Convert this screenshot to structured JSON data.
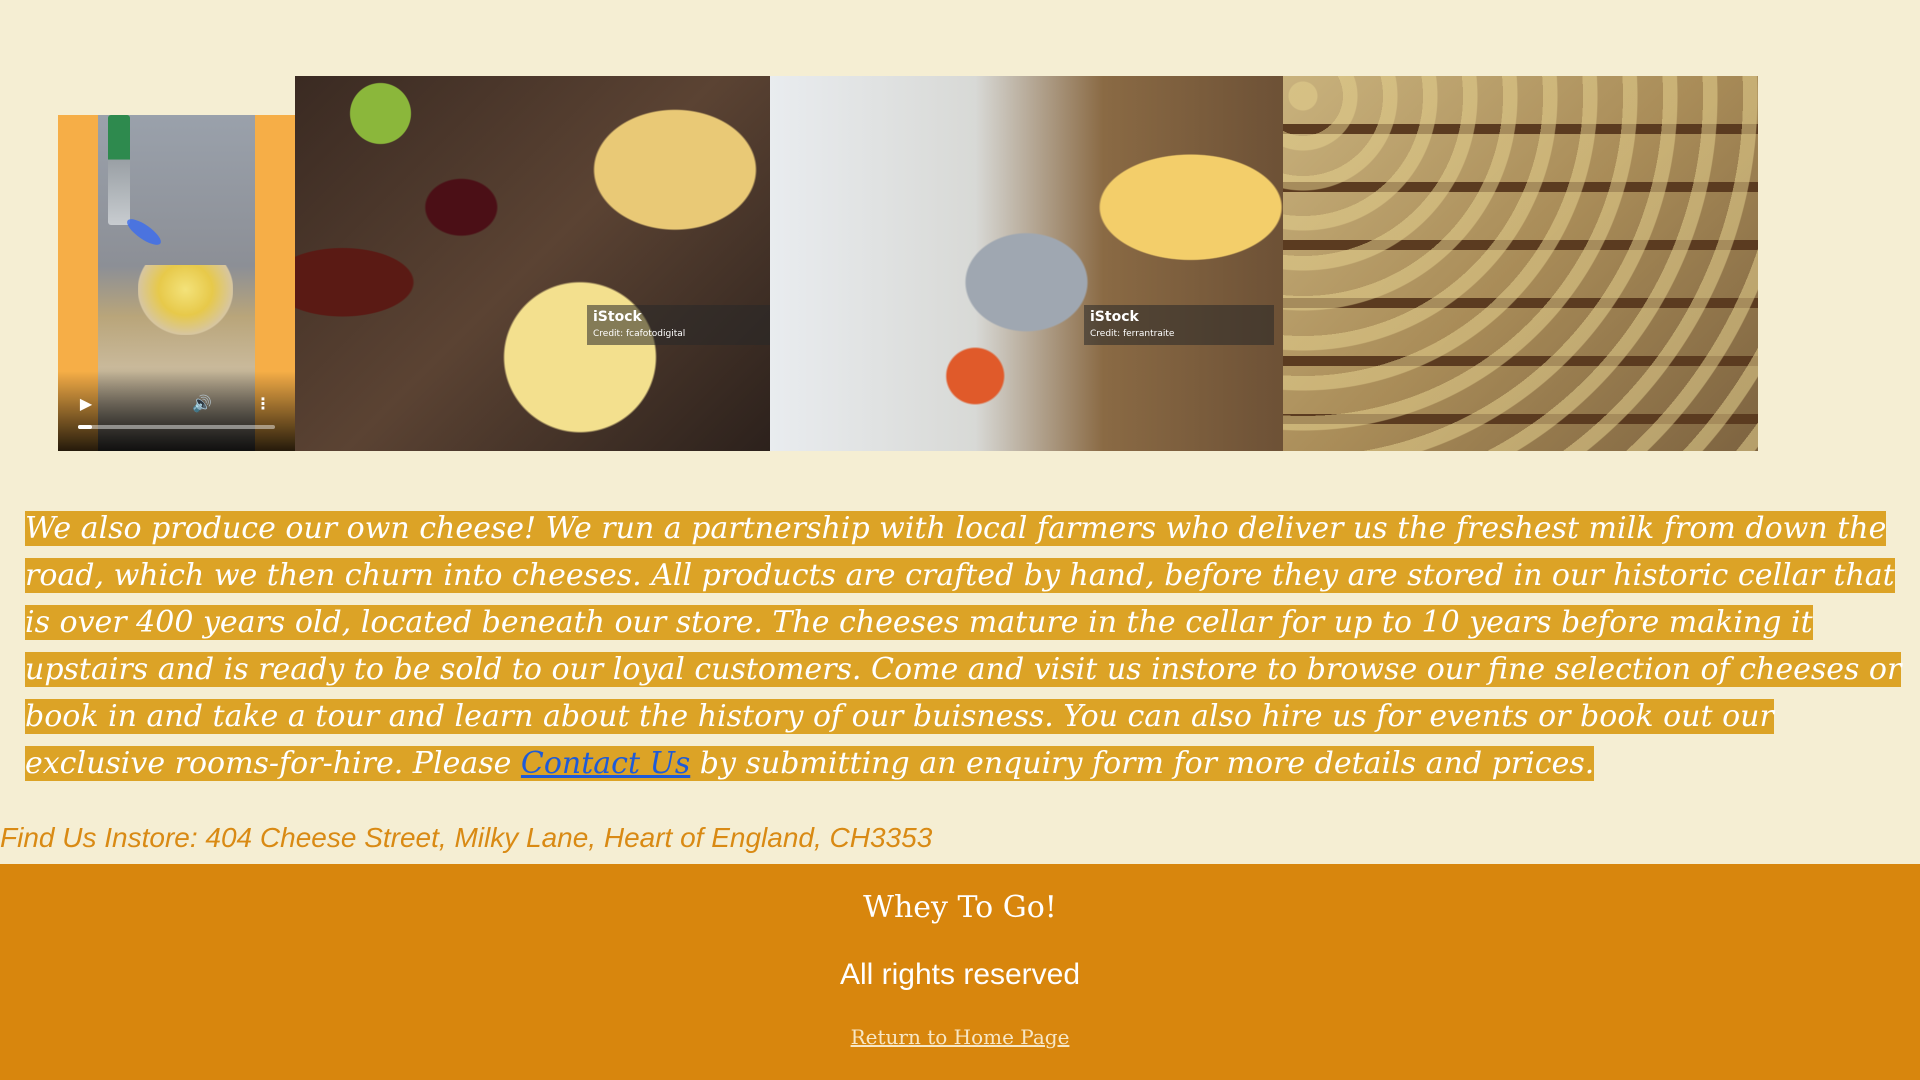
{
  "gallery": {
    "video": {
      "controls": {
        "play_icon": "play-icon",
        "volume_icon": "volume-icon",
        "more_icon": "more-vertical-icon",
        "progress": 0.07
      }
    },
    "photos": [
      {
        "watermark_brand": "iStock",
        "watermark_credit": "Credit: fcafotodigital"
      },
      {
        "watermark_brand": "iStock",
        "watermark_credit": "Credit: ferrantraite"
      },
      {}
    ]
  },
  "intro": {
    "text_before_link": "We also produce our own cheese! We run a partnership with local farmers who deliver us the freshest milk from down the road, which we then churn into cheeses. All products are crafted by hand, before they are stored in our historic cellar that is over 400 years old, located beneath our store. The cheeses mature in the cellar for up to 10 years before making it upstairs and is ready to be sold to our loyal customers. Come and visit us instore to browse our fine selection of cheeses or book in and take a tour and learn about the history of our buisness. You can also hire us for events or book out our exclusive rooms-for-hire. Please ",
    "link_label": "Contact Us",
    "text_after_link": " by submitting an enquiry form for more details and prices."
  },
  "address": "Find Us Instore: 404 Cheese Street, Milky Lane, Heart of England, CH3353",
  "footer": {
    "brand": "Whey To Go!",
    "rights": "All rights reserved",
    "home_link": "Return to Home Page"
  },
  "colors": {
    "background": "#f5eed3",
    "highlight": "#dca326",
    "footer": "#d8860d",
    "link": "#1e5bd8",
    "address": "#d98a14"
  }
}
